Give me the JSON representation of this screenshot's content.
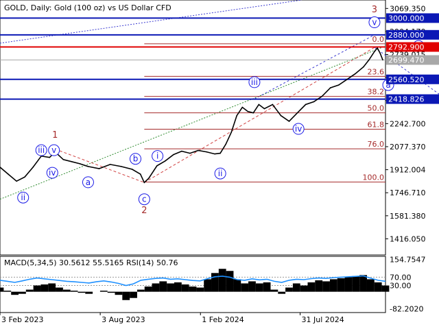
{
  "header": {
    "title": "GOLD, Daily:  Gold (100 oz) vs US Dollar CFD"
  },
  "chart_data": {
    "type": "line",
    "instrument": "GOLD",
    "timeframe": "Daily",
    "price_axis": {
      "ylim": [
        1300,
        3130
      ],
      "ticks": [
        "3069.350",
        "2904.170",
        "2739.015",
        "2573.860",
        "2408.695",
        "2242.700",
        "2077.370",
        "1912.004",
        "1746.710",
        "1581.380",
        "1416.050"
      ],
      "tick_values": [
        3069.35,
        2904.17,
        2739.015,
        2573.86,
        2408.695,
        2242.7,
        2077.37,
        1912.004,
        1746.71,
        1581.38,
        1416.05
      ]
    },
    "time_axis": {
      "labels": [
        "3 Feb 2023",
        "3 Aug 2023",
        "1 Feb 2024",
        "31 Jul 2024"
      ],
      "label_positions": [
        0,
        182,
        364,
        545
      ]
    },
    "levels": [
      {
        "label": "3000.000",
        "value": 3000.0,
        "color": "#0b18b5"
      },
      {
        "label": "2880.000",
        "value": 2880.0,
        "color": "#0b18b5"
      },
      {
        "label": "2792.900",
        "value": 2792.9,
        "color": "#e00000"
      },
      {
        "label": "2699.470",
        "value": 2699.47,
        "color": "#a8a8a8"
      },
      {
        "label": "2560.520",
        "value": 2560.52,
        "color": "#0b18b5"
      },
      {
        "label": "2418.826",
        "value": 2418.826,
        "color": "#0b18b5"
      }
    ],
    "fibonacci": [
      {
        "label": "0.0",
        "value": 2816.0
      },
      {
        "label": "23.6",
        "value": 2582.0
      },
      {
        "label": "38.2",
        "value": 2438.0
      },
      {
        "label": "50.0",
        "value": 2320.0
      },
      {
        "label": "61.8",
        "value": 2203.0
      },
      {
        "label": "76.0",
        "value": 2062.0
      },
      {
        "label": "100.0",
        "value": 1823.0
      }
    ],
    "wave_labels": [
      {
        "text": "1",
        "day": 100,
        "price": 2160,
        "style": "red"
      },
      {
        "text": "iii",
        "day": 75,
        "price": 2052,
        "style": "blue"
      },
      {
        "text": "v",
        "day": 98,
        "price": 2052,
        "style": "blue"
      },
      {
        "text": "iv",
        "day": 95,
        "price": 1890,
        "style": "blue"
      },
      {
        "text": "ii",
        "day": 42,
        "price": 1712,
        "style": "blue"
      },
      {
        "text": "a",
        "day": 160,
        "price": 1822,
        "style": "blue"
      },
      {
        "text": "b",
        "day": 246,
        "price": 1990,
        "style": "blue"
      },
      {
        "text": "c",
        "day": 262,
        "price": 1700,
        "style": "blue"
      },
      {
        "text": "2",
        "day": 262,
        "price": 1620,
        "style": "red"
      },
      {
        "text": "i",
        "day": 286,
        "price": 2010,
        "style": "blue"
      },
      {
        "text": "ii",
        "day": 400,
        "price": 1885,
        "style": "blue"
      },
      {
        "text": "iii",
        "day": 462,
        "price": 2540,
        "style": "blue"
      },
      {
        "text": "iv",
        "day": 542,
        "price": 2205,
        "style": "blue"
      },
      {
        "text": "3",
        "day": 680,
        "price": 3060,
        "style": "red"
      },
      {
        "text": "v",
        "day": 680,
        "price": 2970,
        "style": "blue"
      },
      {
        "text": "b",
        "day": 760,
        "price": 2800,
        "style": "blue"
      },
      {
        "text": "a",
        "day": 705,
        "price": 2520,
        "style": "blue"
      },
      {
        "text": "c",
        "day": 806,
        "price": 2405,
        "style": "blue"
      }
    ],
    "series": [
      {
        "x": [
          0,
          15,
          30,
          45,
          60,
          75,
          90,
          100,
          115,
          130,
          145,
          160,
          180,
          200,
          220,
          240,
          255,
          262,
          270,
          285,
          300,
          315,
          330,
          345,
          360,
          375,
          390,
          400,
          410,
          420,
          430,
          440,
          450,
          460,
          470,
          480,
          495,
          510,
          525,
          540,
          555,
          570,
          585,
          600,
          615,
          630,
          645,
          660,
          670,
          680,
          685,
          690,
          695
        ],
        "values": [
          1930,
          1880,
          1830,
          1860,
          1930,
          2010,
          2000,
          2040,
          1985,
          1970,
          1955,
          1935,
          1920,
          1950,
          1935,
          1915,
          1880,
          1820,
          1850,
          1940,
          1975,
          2020,
          2045,
          2030,
          2050,
          2040,
          2025,
          2030,
          2095,
          2180,
          2300,
          2360,
          2330,
          2320,
          2380,
          2350,
          2380,
          2300,
          2260,
          2320,
          2380,
          2400,
          2440,
          2500,
          2520,
          2560,
          2600,
          2650,
          2700,
          2760,
          2785,
          2750,
          2700
        ]
      }
    ]
  },
  "indicator": {
    "label": "MACD(5,34,5) 30.5612 55.5165 RSI(14) 50.76",
    "ticks": [
      "154.7547",
      "70.00",
      "30.00",
      "-82.2020"
    ],
    "ylim": [
      -100,
      170
    ],
    "rsi": [
      55,
      50,
      45,
      52,
      60,
      66,
      62,
      58,
      54,
      50,
      48,
      45,
      42,
      48,
      52,
      47,
      40,
      30,
      38,
      55,
      60,
      64,
      66,
      60,
      62,
      58,
      54,
      52,
      63,
      72,
      75,
      70,
      58,
      55,
      62,
      57,
      60,
      50,
      45,
      55,
      60,
      58,
      63,
      66,
      64,
      68,
      70,
      72,
      74,
      76,
      65,
      55,
      50
    ],
    "macd": [
      20,
      5,
      -15,
      -10,
      10,
      30,
      35,
      40,
      20,
      10,
      5,
      -5,
      -10,
      0,
      5,
      -5,
      -15,
      -40,
      -30,
      10,
      25,
      40,
      50,
      40,
      45,
      35,
      25,
      20,
      60,
      90,
      110,
      100,
      60,
      40,
      50,
      40,
      45,
      10,
      -10,
      20,
      40,
      30,
      45,
      55,
      50,
      60,
      65,
      70,
      75,
      80,
      60,
      45,
      30
    ]
  },
  "badges": {
    "level_3000": "3000.000",
    "level_2880": "2880.000",
    "level_2792": "2792.900",
    "level_2699": "2699.470",
    "level_2560": "2560.520",
    "level_2418": "2418.826"
  }
}
